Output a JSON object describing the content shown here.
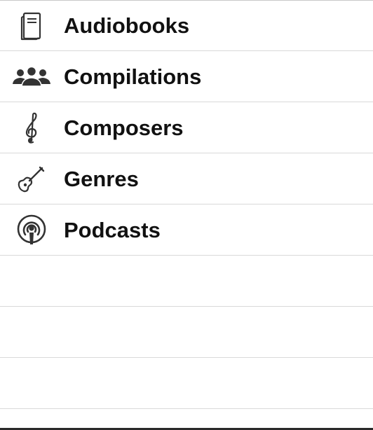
{
  "list": {
    "items": [
      {
        "label": "Audiobooks",
        "icon": "book-icon"
      },
      {
        "label": "Compilations",
        "icon": "people-group-icon"
      },
      {
        "label": "Composers",
        "icon": "treble-clef-icon"
      },
      {
        "label": "Genres",
        "icon": "guitar-icon"
      },
      {
        "label": "Podcasts",
        "icon": "podcast-icon"
      }
    ],
    "empty_rows": 3
  },
  "colors": {
    "separator": "#d9d9d9",
    "text": "#111111",
    "icon": "#333333"
  }
}
